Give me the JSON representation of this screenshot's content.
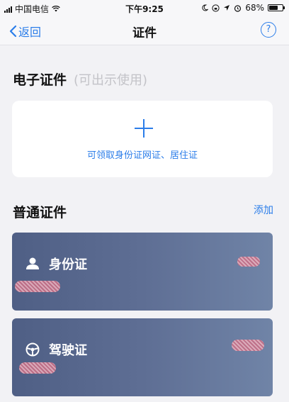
{
  "status_bar": {
    "carrier": "中国电信",
    "time": "下午9:25",
    "battery": "68%"
  },
  "nav": {
    "back_label": "返回",
    "title": "证件",
    "help_label": "?"
  },
  "electronic": {
    "title": "电子证件",
    "subtitle": "(可出示使用)",
    "card_text": "可领取身份证网证、居住证"
  },
  "regular": {
    "title": "普通证件",
    "add_label": "添加"
  },
  "documents": [
    {
      "label": "身份证",
      "icon": "person-icon"
    },
    {
      "label": "驾驶证",
      "icon": "steering-wheel-icon"
    }
  ],
  "colors": {
    "accent": "#2b7de9",
    "card_gradient_start": "#4f5f85",
    "card_gradient_end": "#7084a7"
  }
}
